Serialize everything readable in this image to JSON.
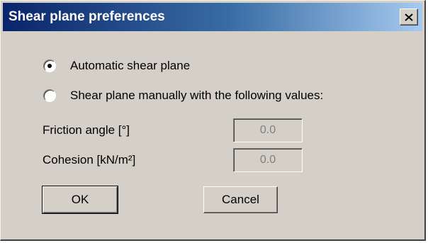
{
  "dialog": {
    "title": "Shear plane preferences",
    "close_glyph": "✕"
  },
  "options": {
    "automatic": {
      "label": "Automatic shear plane",
      "selected": true
    },
    "manual": {
      "label": "Shear plane manually with the following values:",
      "selected": false
    }
  },
  "fields": {
    "friction_angle": {
      "label": "Friction angle [°]",
      "value": "0.0",
      "enabled": false
    },
    "cohesion": {
      "label": "Cohesion [kN/m²]",
      "value": "0.0",
      "enabled": false
    }
  },
  "buttons": {
    "ok": "OK",
    "cancel": "Cancel"
  },
  "colors": {
    "dialog_bg": "#d4d0c8",
    "title_start": "#0a246a",
    "title_end": "#a6caf0"
  }
}
